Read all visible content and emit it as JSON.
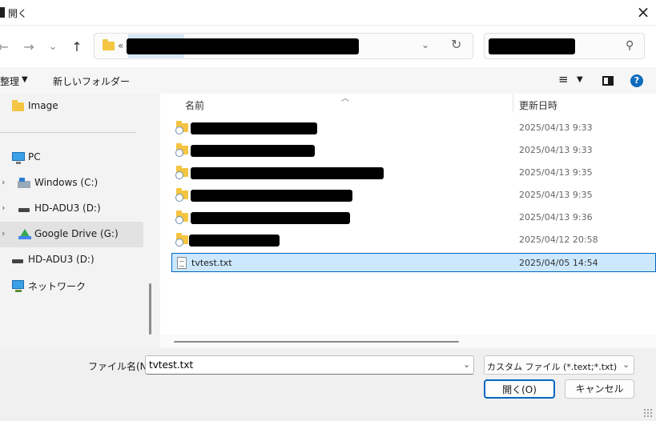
{
  "window": {
    "title": "開く"
  },
  "nav": {
    "back": "←",
    "forward": "→",
    "recent": "⌄",
    "up": "↑",
    "address_prefix": "«",
    "address_dropdown": "⌄",
    "refresh": "↻"
  },
  "search": {
    "icon": "search-icon"
  },
  "toolbar": {
    "organize": "整理",
    "new_folder": "新しいフォルダー",
    "view_icon": "≡",
    "help": "?"
  },
  "sidebar": {
    "items": [
      {
        "label": "Image",
        "icon": "folder-icon"
      },
      {
        "label": "PC",
        "icon": "pc-icon"
      },
      {
        "label": "Windows (C:)",
        "icon": "windows-drive-icon"
      },
      {
        "label": "HD-ADU3 (D:)",
        "icon": "drive-icon"
      },
      {
        "label": "Google Drive (G:)",
        "icon": "google-drive-icon"
      },
      {
        "label": "HD-ADU3 (D:)",
        "icon": "drive-icon"
      },
      {
        "label": "ネットワーク",
        "icon": "network-icon"
      }
    ]
  },
  "filelist": {
    "columns": {
      "name": "名前",
      "modified": "更新日時"
    },
    "rows": [
      {
        "name": "",
        "modified": "2025/04/13 9:33",
        "type": "folder"
      },
      {
        "name": "",
        "modified": "2025/04/13 9:33",
        "type": "folder"
      },
      {
        "name": "",
        "modified": "2025/04/13 9:35",
        "type": "folder"
      },
      {
        "name": "",
        "modified": "2025/04/13 9:35",
        "type": "folder"
      },
      {
        "name": "",
        "modified": "2025/04/13 9:36",
        "type": "folder"
      },
      {
        "name": "",
        "modified": "2025/04/12 20:58",
        "type": "folder"
      },
      {
        "name": "tvtest.txt",
        "modified": "2025/04/05 14:54",
        "type": "text-file",
        "selected": true
      }
    ]
  },
  "bottom": {
    "filename_label": "ファイル名(N):",
    "filename_value": "tvtest.txt",
    "filter_value": "カスタム ファイル (*.text;*.txt)",
    "open_label": "開く(O)",
    "cancel_label": "キャンセル"
  },
  "colors": {
    "accent": "#0067c0",
    "selected_row": "#cce8ff",
    "folder": "#f4c542"
  }
}
